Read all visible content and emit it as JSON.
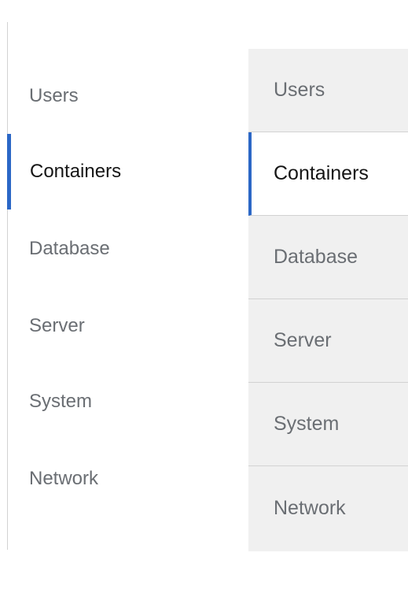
{
  "left_tabs": {
    "items": [
      {
        "label": "Users"
      },
      {
        "label": "Containers",
        "active": true
      },
      {
        "label": "Database"
      },
      {
        "label": "Server"
      },
      {
        "label": "System"
      },
      {
        "label": "Network"
      }
    ]
  },
  "right_tabs": {
    "items": [
      {
        "label": "Users"
      },
      {
        "label": "Containers",
        "active": true
      },
      {
        "label": "Database"
      },
      {
        "label": "Server"
      },
      {
        "label": "System"
      },
      {
        "label": "Network"
      }
    ]
  },
  "colors": {
    "accent": "#2b67c6",
    "inactive_text": "#6a6e73",
    "active_text": "#151515",
    "box_background": "#f0f0f0",
    "divider": "#d2d2d2"
  }
}
